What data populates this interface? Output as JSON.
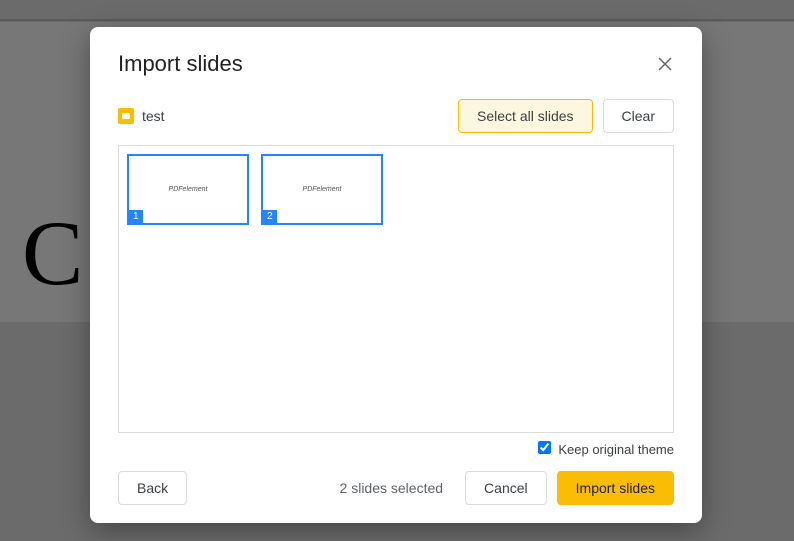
{
  "modal": {
    "title": "Import slides",
    "file_name": "test",
    "select_all_label": "Select all slides",
    "clear_label": "Clear",
    "keep_theme_label": "Keep original theme",
    "keep_theme_checked": true,
    "selected_status": "2 slides selected",
    "back_label": "Back",
    "cancel_label": "Cancel",
    "import_label": "Import slides"
  },
  "slides": [
    {
      "number": "1",
      "content": "PDFelement",
      "selected": true
    },
    {
      "number": "2",
      "content": "PDFelement",
      "selected": true
    }
  ],
  "background": {
    "letter": "C"
  }
}
